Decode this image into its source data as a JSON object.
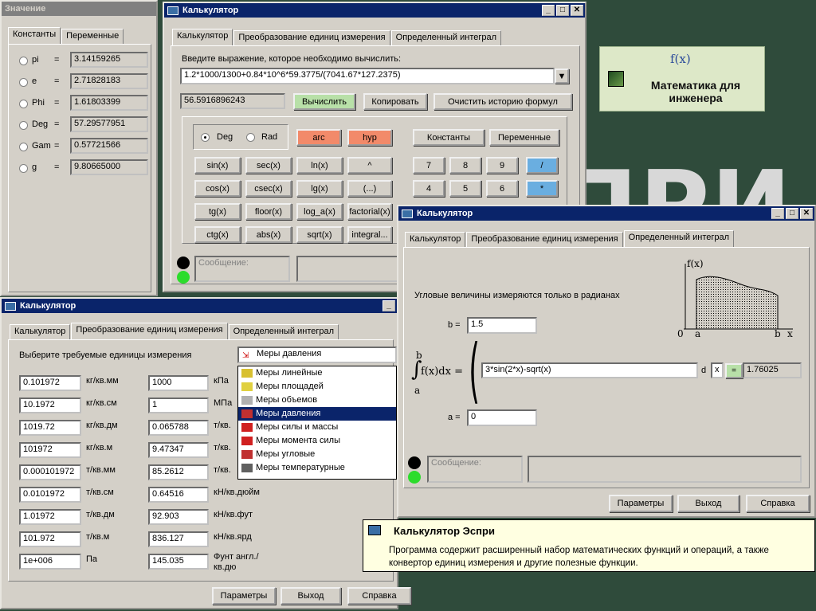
{
  "background": {
    "letters": "ПРИ",
    "logo": {
      "fx": "f(x)",
      "line1": "Математика для",
      "line2": "инженера"
    }
  },
  "w1": {
    "title": "Значение",
    "tabs": [
      "Константы",
      "Переменные"
    ],
    "constants": [
      {
        "name": "pi",
        "eq": "=",
        "value": "3.14159265"
      },
      {
        "name": "e",
        "eq": "=",
        "value": "2.71828183"
      },
      {
        "name": "Phi",
        "eq": "=",
        "value": "1.61803399"
      },
      {
        "name": "Deg",
        "eq": "=",
        "value": "57.29577951"
      },
      {
        "name": "Gam",
        "eq": "=",
        "value": "0.57721566"
      },
      {
        "name": "g",
        "eq": "=",
        "value": "9.80665000"
      }
    ]
  },
  "w2": {
    "title": "Калькулятор",
    "tabs": [
      "Калькулятор",
      "Преобразование единиц измерения",
      "Определенный интеграл"
    ],
    "prompt": "Введите выражение, которое необходимо вычислить:",
    "expression": "1.2*1000/1300+0.84*10^6*59.3775/(7041.67*127.2375)",
    "result": "56.5916896243",
    "btn_calc": "Вычислить",
    "btn_copy": "Копировать",
    "btn_clear": "Очистить историю формул",
    "deg": "Deg",
    "rad": "Rad",
    "arc": "arc",
    "hyp": "hyp",
    "constants": "Константы",
    "variables": "Переменные",
    "funcs": [
      [
        "sin(x)",
        "sec(x)",
        "ln(x)",
        "^"
      ],
      [
        "cos(x)",
        "csec(x)",
        "lg(x)",
        "(...)"
      ],
      [
        "tg(x)",
        "floor(x)",
        "log_a(x)",
        "factorial(x)"
      ],
      [
        "ctg(x)",
        "abs(x)",
        "sqrt(x)",
        "integral..."
      ]
    ],
    "digits": [
      [
        "7",
        "8",
        "9",
        "/"
      ],
      [
        "4",
        "5",
        "6",
        "*"
      ]
    ],
    "message": "Сообщение:"
  },
  "w3": {
    "title": "Калькулятор",
    "tabs": [
      "Калькулятор",
      "Преобразование единиц измерения",
      "Определенный интеграл"
    ],
    "prompt": "Выберите требуемые единицы измерения",
    "dropdown": "Меры давления",
    "dd_items": [
      "Меры линейные",
      "Меры площадей",
      "Меры объемов",
      "Меры давления",
      "Меры силы и массы",
      "Меры момента силы",
      "Меры угловые",
      "Меры температурные"
    ],
    "left": [
      {
        "v": "0.101972",
        "u": "кг/кв.мм"
      },
      {
        "v": "10.1972",
        "u": "кг/кв.см"
      },
      {
        "v": "1019.72",
        "u": "кг/кв.дм"
      },
      {
        "v": "101972",
        "u": "кг/кв.м"
      },
      {
        "v": "0.000101972",
        "u": "т/кв.мм"
      },
      {
        "v": "0.0101972",
        "u": "т/кв.см"
      },
      {
        "v": "1.01972",
        "u": "т/кв.дм"
      },
      {
        "v": "101.972",
        "u": "т/кв.м"
      },
      {
        "v": "1e+006",
        "u": "Па"
      }
    ],
    "right": [
      {
        "v": "1000",
        "u": "кПа"
      },
      {
        "v": "1",
        "u": "МПа"
      },
      {
        "v": "0.065788",
        "u": "т/кв."
      },
      {
        "v": "9.47347",
        "u": "т/кв."
      },
      {
        "v": "85.2612",
        "u": "т/кв."
      },
      {
        "v": "0.64516",
        "u": "кН/кв.дюйм"
      },
      {
        "v": "92.903",
        "u": "кН/кв.фут"
      },
      {
        "v": "836.127",
        "u": "кН/кв.ярд"
      },
      {
        "v": "145.035",
        "u": "Фунт англ./кв.дю"
      }
    ],
    "btn_params": "Параметры",
    "btn_exit": "Выход",
    "btn_help": "Справка"
  },
  "w4": {
    "title": "Калькулятор",
    "tabs": [
      "Калькулятор",
      "Преобразование единиц измерения",
      "Определенный интеграл"
    ],
    "note": "Угловые величины измеряются только в радианах",
    "b_label": "b =",
    "b": "1.5",
    "a_label": "a =",
    "a": "0",
    "formula": "3*sin(2*x)-sqrt(x)",
    "d": "d",
    "var": "x",
    "eq_btn": "=",
    "result": "1.76025",
    "int_upper": "b",
    "int_lower": "a",
    "int_body": "f(x)dx =",
    "graph": {
      "fx": "f(x)",
      "zero": "0",
      "a": "a",
      "b": "b",
      "x": "x"
    },
    "message": "Сообщение:",
    "btn_params": "Параметры",
    "btn_exit": "Выход",
    "btn_help": "Справка"
  },
  "tip": {
    "title": "Калькулятор Эспри",
    "text": "Программа содержит расширенный набор математических функций и операций, а также конвертор единиц измерения и другие полезные функции."
  }
}
